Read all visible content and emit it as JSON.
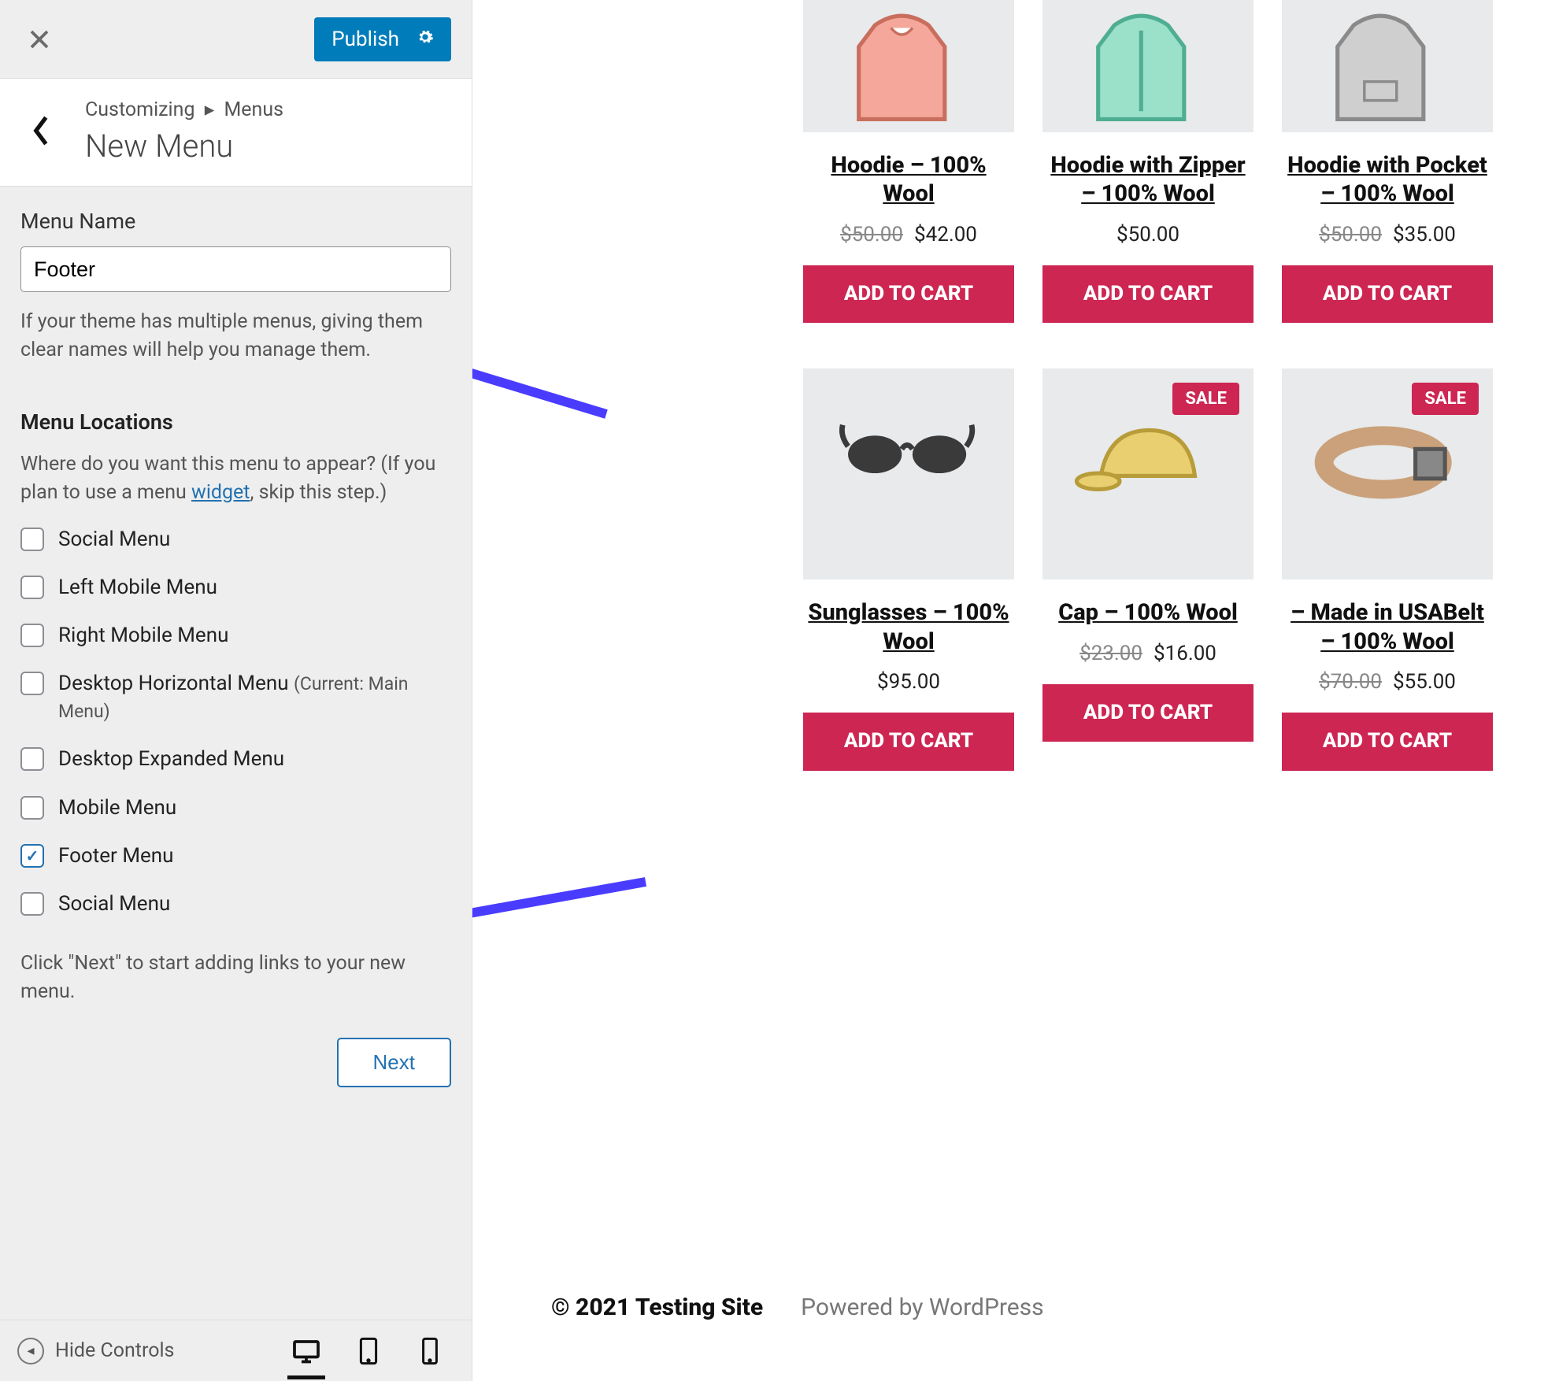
{
  "header": {
    "publish_label": "Publish"
  },
  "breadcrumb": {
    "root": "Customizing",
    "section": "Menus",
    "title": "New Menu"
  },
  "menu_name": {
    "label": "Menu Name",
    "value": "Footer",
    "help": "If your theme has multiple menus, giving them clear names will help you manage them."
  },
  "locations": {
    "heading": "Menu Locations",
    "help_pre": "Where do you want this menu to appear? (If you plan to use a menu ",
    "help_link": "widget",
    "help_post": ", skip this step.)",
    "items": [
      {
        "label": "Social Menu",
        "checked": false
      },
      {
        "label": "Left Mobile Menu",
        "checked": false
      },
      {
        "label": "Right Mobile Menu",
        "checked": false
      },
      {
        "label": "Desktop Horizontal Menu",
        "sub": "(Current: Main Menu)",
        "checked": false
      },
      {
        "label": "Desktop Expanded Menu",
        "checked": false
      },
      {
        "label": "Mobile Menu",
        "checked": false
      },
      {
        "label": "Footer Menu",
        "checked": true
      },
      {
        "label": "Social Menu",
        "checked": false
      }
    ],
    "after_help": "Click \"Next\" to start adding links to your new menu.",
    "next_label": "Next"
  },
  "footer_bar": {
    "hide_label": "Hide Controls"
  },
  "products": [
    {
      "title": "Hoodie – 100% Wool",
      "old_price": "$50.00",
      "price": "$42.00",
      "sale": false,
      "button": "ADD TO CART",
      "glyph": "hoodie-pink"
    },
    {
      "title": "Hoodie with Zipper – 100% Wool",
      "old_price": null,
      "price": "$50.00",
      "sale": false,
      "button": "ADD TO CART",
      "glyph": "hoodie-teal"
    },
    {
      "title": "Hoodie with Pocket – 100% Wool",
      "old_price": "$50.00",
      "price": "$35.00",
      "sale": false,
      "button": "ADD TO CART",
      "glyph": "hoodie-grey"
    },
    {
      "title": "Sunglasses – 100% Wool",
      "old_price": null,
      "price": "$95.00",
      "sale": false,
      "button": "ADD TO CART",
      "glyph": "sunglasses"
    },
    {
      "title": "Cap – 100% Wool",
      "old_price": "$23.00",
      "price": "$16.00",
      "sale": true,
      "button": "ADD TO CART",
      "glyph": "cap"
    },
    {
      "title": "– Made in USABelt – 100% Wool",
      "old_price": "$70.00",
      "price": "$55.00",
      "sale": true,
      "button": "ADD TO CART",
      "glyph": "belt"
    }
  ],
  "sale_label": "SALE",
  "site_footer": {
    "copyright": "© 2021 Testing Site",
    "powered": "Powered by WordPress"
  }
}
